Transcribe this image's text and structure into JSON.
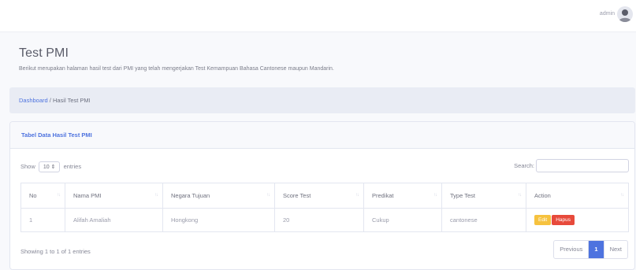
{
  "topbar": {
    "user": "admin"
  },
  "page": {
    "title": "Test PMI",
    "description": "Berikut merupakan halaman hasil test dari PMI yang telah mengerjakan Test Kemampuan Bahasa Cantonese maupun Mandarin."
  },
  "breadcrumb": {
    "link": "Dashboard",
    "separator": " / ",
    "current": "Hasil Test PMI"
  },
  "card": {
    "title": "Tabel Data Hasil Test PMI",
    "show_label": "Show",
    "entries_value": "10",
    "entries_label": "entries",
    "search_label": "Search:",
    "search_value": "",
    "columns": [
      "No",
      "Nama PMI",
      "Negara Tujuan",
      "Score Test",
      "Predikat",
      "Type Test",
      "Action"
    ],
    "rows": [
      {
        "no": "1",
        "nama": "Alifah Amaliah",
        "negara": "Hongkong",
        "score": "20",
        "predikat": "Cukup",
        "type": "cantonese",
        "edit": "Edit",
        "hapus": "Hapus"
      }
    ],
    "info": "Showing 1 to 1 of 1 entries",
    "pagination": {
      "previous": "Previous",
      "current": "1",
      "next": "Next"
    }
  },
  "colors": {
    "primary": "#4e73df",
    "warning": "#f6c23e",
    "danger": "#e74a3b"
  }
}
